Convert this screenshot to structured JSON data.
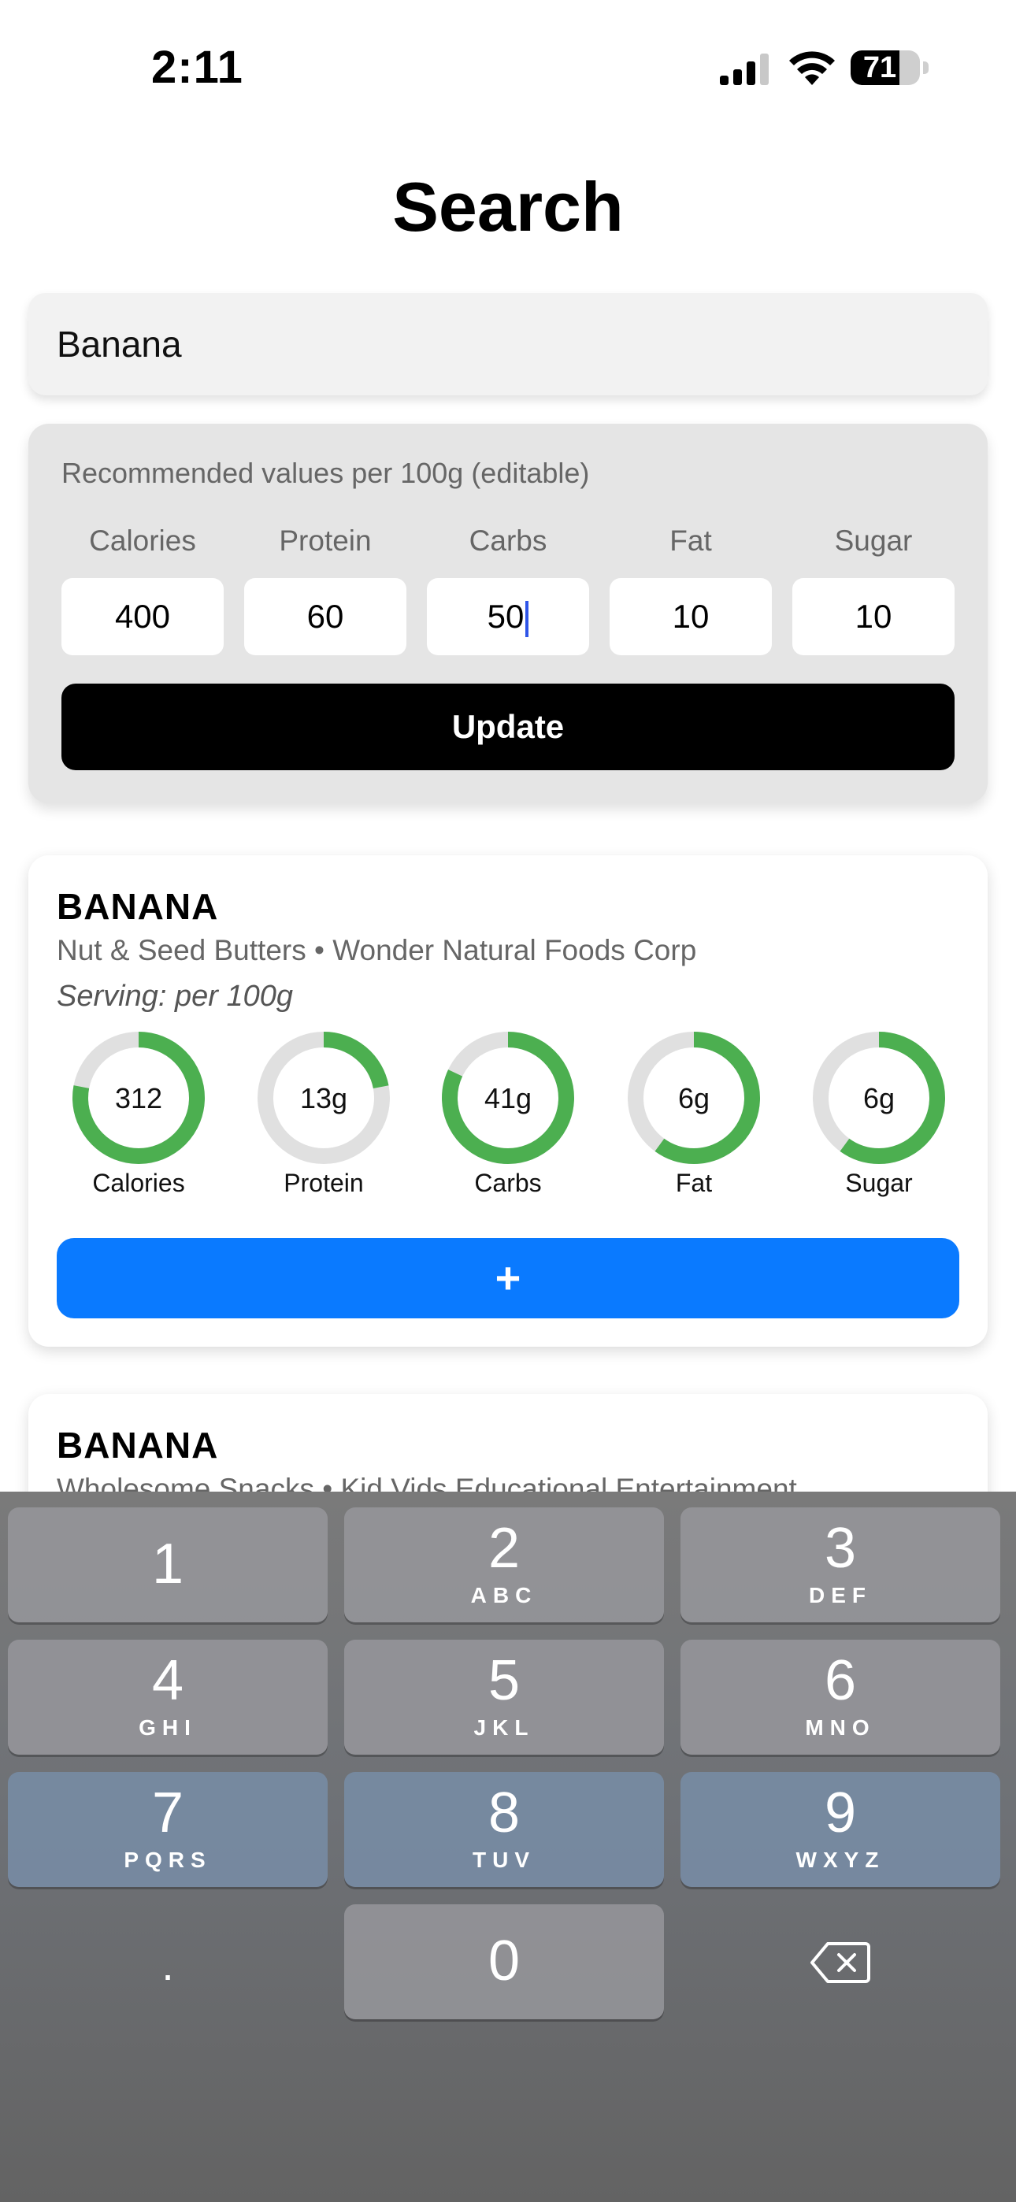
{
  "status_bar": {
    "time": "2:11",
    "battery": "71",
    "battery_level": 0.71
  },
  "page": {
    "title": "Search"
  },
  "search": {
    "value": "Banana"
  },
  "recommended": {
    "label": "Recommended values per 100g (editable)",
    "fields": [
      {
        "label": "Calories",
        "value": "400"
      },
      {
        "label": "Protein",
        "value": "60"
      },
      {
        "label": "Carbs",
        "value": "50"
      },
      {
        "label": "Fat",
        "value": "10"
      },
      {
        "label": "Sugar",
        "value": "10"
      }
    ],
    "update_label": "Update"
  },
  "results": [
    {
      "title": "BANANA",
      "subtitle": "Nut & Seed Butters • Wonder Natural Foods Corp",
      "serving": "Serving: per 100g",
      "add_label": "+",
      "rings": [
        {
          "value": "312",
          "label": "Calories",
          "fraction": 0.78
        },
        {
          "value": "13g",
          "label": "Protein",
          "fraction": 0.22
        },
        {
          "value": "41g",
          "label": "Carbs",
          "fraction": 0.82
        },
        {
          "value": "6g",
          "label": "Fat",
          "fraction": 0.6
        },
        {
          "value": "6g",
          "label": "Sugar",
          "fraction": 0.6
        }
      ]
    },
    {
      "title": "BANANA",
      "subtitle": "Wholesome Snacks • Kid Vids Educational Entertainment"
    }
  ],
  "keyboard": {
    "keys": [
      {
        "digit": "1",
        "letters": ""
      },
      {
        "digit": "2",
        "letters": "ABC"
      },
      {
        "digit": "3",
        "letters": "DEF"
      },
      {
        "digit": "4",
        "letters": "GHI"
      },
      {
        "digit": "5",
        "letters": "JKL"
      },
      {
        "digit": "6",
        "letters": "MNO"
      },
      {
        "digit": "7",
        "letters": "PQRS"
      },
      {
        "digit": "8",
        "letters": "TUV"
      },
      {
        "digit": "9",
        "letters": "WXYZ"
      }
    ],
    "dot": ".",
    "zero": "0",
    "delete_icon": "backspace-icon"
  },
  "colors": {
    "ring_fill": "#4caf50",
    "ring_track": "#e0e0e0",
    "add_button": "#0a7aff",
    "update_button": "#000000"
  }
}
